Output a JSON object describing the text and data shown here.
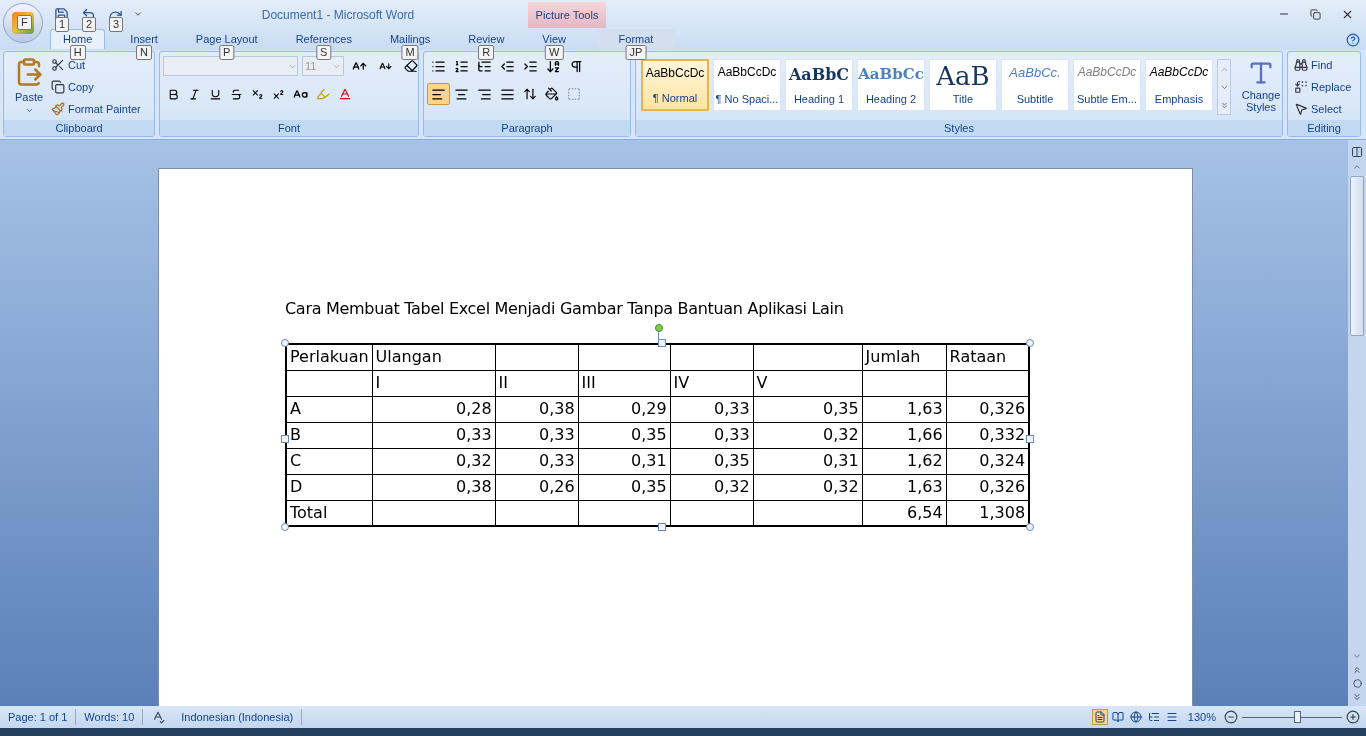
{
  "window": {
    "title": "Document1 - Microsoft Word",
    "contextual_title": "Picture Tools"
  },
  "office_button": {
    "keytip": "F"
  },
  "quick_access": [
    {
      "kind": "save",
      "keytip": "1"
    },
    {
      "kind": "undo",
      "keytip": "2"
    },
    {
      "kind": "repeat",
      "keytip": "3"
    }
  ],
  "tabs": [
    {
      "label": "Home",
      "keytip": "H",
      "selected": true
    },
    {
      "label": "Insert",
      "keytip": "N",
      "selected": false
    },
    {
      "label": "Page Layout",
      "keytip": "P",
      "selected": false
    },
    {
      "label": "References",
      "keytip": "S",
      "selected": false
    },
    {
      "label": "Mailings",
      "keytip": "M",
      "selected": false
    },
    {
      "label": "Review",
      "keytip": "R",
      "selected": false
    },
    {
      "label": "View",
      "keytip": "W",
      "selected": false
    }
  ],
  "contextual_tab": {
    "label": "Format",
    "keytip": "JP",
    "selected": false
  },
  "clipboard": {
    "label": "Clipboard",
    "paste": "Paste",
    "items": [
      {
        "kind": "cut",
        "label": "Cut"
      },
      {
        "kind": "copy",
        "label": "Copy"
      },
      {
        "kind": "painter",
        "label": "Format Painter"
      }
    ]
  },
  "font": {
    "label": "Font",
    "size": "11"
  },
  "paragraph": {
    "label": "Paragraph",
    "alignments": [
      {
        "kind": "left",
        "selected": true
      },
      {
        "kind": "center",
        "selected": false
      },
      {
        "kind": "right",
        "selected": false
      },
      {
        "kind": "justify",
        "selected": false
      }
    ]
  },
  "styles": {
    "label": "Styles",
    "items": [
      {
        "preview": "AaBbCcDc",
        "label": "¶ Normal",
        "kind": "normal",
        "selected": true
      },
      {
        "preview": "AaBbCcDc",
        "label": "¶ No Spaci...",
        "kind": "normal",
        "selected": false
      },
      {
        "preview": "AaBbC",
        "label": "Heading 1",
        "kind": "heading1",
        "selected": false
      },
      {
        "preview": "AaBbCc",
        "label": "Heading 2",
        "kind": "heading2",
        "selected": false
      },
      {
        "preview": "AaB",
        "label": "Title",
        "kind": "title",
        "selected": false
      },
      {
        "preview": "AaBbCc.",
        "label": "Subtitle",
        "kind": "subtitle",
        "selected": false
      },
      {
        "preview": "AaBbCcDc",
        "label": "Subtle Em...",
        "kind": "subtle",
        "selected": false
      },
      {
        "preview": "AaBbCcDc",
        "label": "Emphasis",
        "kind": "emphasis",
        "selected": false
      }
    ],
    "change_styles": "Change Styles"
  },
  "editing": {
    "label": "Editing",
    "items": [
      {
        "kind": "find",
        "label": "Find"
      },
      {
        "kind": "replace",
        "label": "Replace"
      },
      {
        "kind": "select",
        "label": "Select"
      }
    ]
  },
  "document": {
    "heading": "Cara Membuat Tabel Excel Menjadi Gambar Tanpa Bantuan Aplikasi Lain",
    "table_rows": [
      {
        "kind": "header",
        "cells": [
          "Perlakuan",
          "Ulangan",
          null,
          null,
          null,
          null,
          "Jumlah",
          "Rataan"
        ]
      },
      {
        "kind": "header",
        "cells": [
          null,
          "I",
          "II",
          "III",
          "IV",
          "V",
          null,
          null
        ]
      },
      {
        "kind": "data",
        "cells": [
          "A",
          "0,28",
          "0,38",
          "0,29",
          "0,33",
          "0,35",
          "1,63",
          "0,326"
        ]
      },
      {
        "kind": "data",
        "cells": [
          "B",
          "0,33",
          "0,33",
          "0,35",
          "0,33",
          "0,32",
          "1,66",
          "0,332"
        ]
      },
      {
        "kind": "data",
        "cells": [
          "C",
          "0,32",
          "0,33",
          "0,31",
          "0,35",
          "0,31",
          "1,62",
          "0,324"
        ]
      },
      {
        "kind": "data",
        "cells": [
          "D",
          "0,38",
          "0,26",
          "0,35",
          "0,32",
          "0,32",
          "1,63",
          "0,326"
        ]
      },
      {
        "kind": "data",
        "cells": [
          "Total",
          null,
          null,
          null,
          null,
          null,
          "6,54",
          "1,308"
        ]
      }
    ]
  },
  "status_bar": {
    "page": "Page: 1 of 1",
    "words": "Words: 10",
    "language": "Indonesian (Indonesia)",
    "views": [
      {
        "kind": "print",
        "selected": true
      },
      {
        "kind": "reading",
        "selected": false
      },
      {
        "kind": "web",
        "selected": false
      },
      {
        "kind": "outline",
        "selected": false
      },
      {
        "kind": "draft",
        "selected": false
      }
    ],
    "zoom": "130%",
    "zoom_slider": {
      "level": 0.55
    }
  }
}
